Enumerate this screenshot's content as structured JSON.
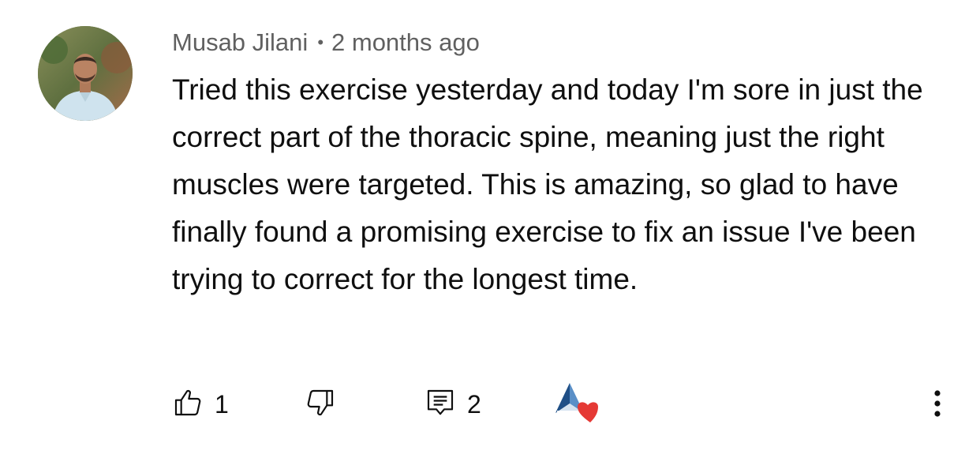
{
  "comment": {
    "author": "Musab Jilani",
    "separator": "•",
    "time": "2 months ago",
    "text": "Tried this exercise yesterday and today I'm sore in just the correct part of the thoracic spine, meaning just the right muscles were targeted. This is amazing, so glad to have finally found a promising exercise to fix an issue I've been trying to correct for the longest time.",
    "avatar_icon": "user-avatar"
  },
  "actions": {
    "like_icon": "thumb-up-icon",
    "like_count": "1",
    "dislike_icon": "thumb-down-icon",
    "reply_icon": "comment-reply-icon",
    "reply_count": "2",
    "creator_heart_icon": "creator-heart-icon",
    "more_icon": "more-vertical-icon"
  },
  "colors": {
    "meta": "#606060",
    "text": "#0f0f0f",
    "heart": "#e53935",
    "logo_blue": "#2c5d8f"
  }
}
